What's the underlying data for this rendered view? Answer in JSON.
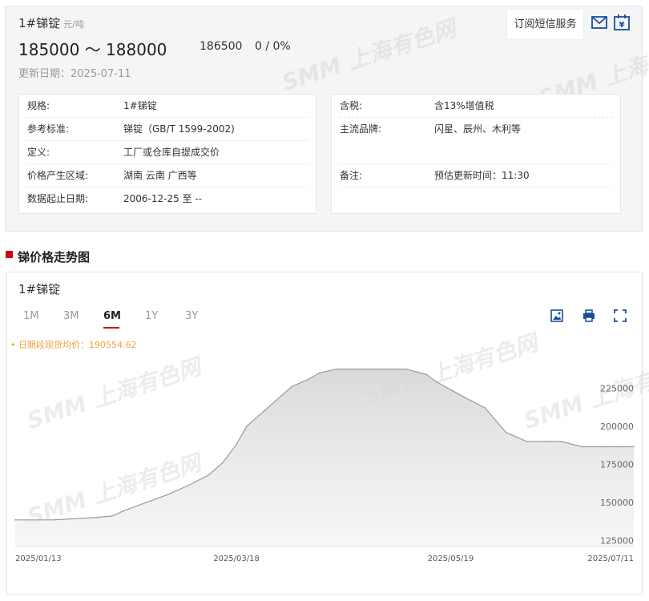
{
  "header": {
    "product_name": "1#锑锭",
    "unit": "元/吨",
    "price_range": "185000 ～ 188000",
    "mid_price": "186500",
    "change": "0 / 0%",
    "update_date": "更新日期：2025-07-11",
    "subscribe_label": "订阅短信服务",
    "watermark": "SMM 上海有色网"
  },
  "info_left": [
    {
      "key": "规格:",
      "value": "1#锑锭"
    },
    {
      "key": "参考标准:",
      "value": "锑锭（GB/T 1599-2002)"
    },
    {
      "key": "定义:",
      "value": "工厂或仓库自提成交价"
    },
    {
      "key": "价格产生区域:",
      "value": "湖南 云南 广西等"
    },
    {
      "key": "数据起止日期:",
      "value": "2006-12-25 至 --"
    }
  ],
  "info_right": [
    {
      "key": "含税:",
      "value": "含13%增值税"
    },
    {
      "key": "主流品牌:",
      "value": "闪星、辰州、木利等"
    },
    {
      "key": "备注:",
      "value": "预估更新时间：11:30"
    }
  ],
  "section": {
    "title": "锑价格走势图"
  },
  "chart": {
    "name": "1#锑锭",
    "tabs": [
      "1M",
      "3M",
      "6M",
      "1Y",
      "3Y"
    ],
    "active_tab": "6M",
    "avg_label": "• 日期段现货均价：190554.62",
    "accent_color": "#d0021b",
    "avg_color": "#f0a03c"
  },
  "chart_data": {
    "type": "area",
    "x": [
      "2025/01/13",
      "2025/01/24",
      "2025/02/05",
      "2025/02/10",
      "2025/02/14",
      "2025/02/20",
      "2025/02/26",
      "2025/03/04",
      "2025/03/10",
      "2025/03/14",
      "2025/03/18",
      "2025/03/21",
      "2025/03/26",
      "2025/03/31",
      "2025/04/03",
      "2025/04/08",
      "2025/04/11",
      "2025/04/16",
      "2025/04/22",
      "2025/04/28",
      "2025/05/06",
      "2025/05/12",
      "2025/05/15",
      "2025/05/19",
      "2025/05/23",
      "2025/05/29",
      "2025/06/04",
      "2025/06/10",
      "2025/06/16",
      "2025/06/20",
      "2025/06/26",
      "2025/07/02",
      "2025/07/08",
      "2025/07/11"
    ],
    "values": [
      138500,
      138500,
      140000,
      141000,
      145000,
      150000,
      155000,
      161000,
      168000,
      176000,
      188000,
      200000,
      210000,
      220000,
      226000,
      231000,
      235000,
      237500,
      237500,
      237500,
      237500,
      234000,
      229000,
      224000,
      219000,
      212000,
      196000,
      190000,
      190000,
      190000,
      186500,
      186500,
      186500,
      186500
    ],
    "xticks": [
      "2025/01/13",
      "2025/03/18",
      "2025/05/19",
      "2025/07/11"
    ],
    "yticks": [
      125000,
      150000,
      175000,
      200000,
      225000
    ],
    "ylim": [
      121000,
      251000
    ],
    "title": "",
    "xlabel": "",
    "ylabel": "",
    "grid": false
  }
}
